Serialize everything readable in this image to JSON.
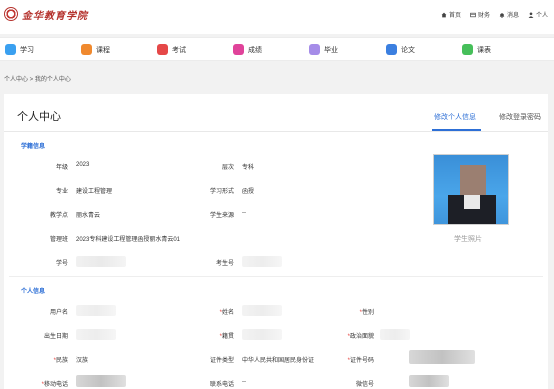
{
  "header": {
    "school_name": "金华教育学院",
    "links": [
      {
        "label": "首页",
        "icon": "home-icon"
      },
      {
        "label": "财务",
        "icon": "finance-icon"
      },
      {
        "label": "消息",
        "icon": "bell-icon"
      },
      {
        "label": "个人",
        "icon": "user-icon"
      }
    ]
  },
  "nav": {
    "items": [
      {
        "label": "学习",
        "icon": "study-icon",
        "color": "#3aa0f0"
      },
      {
        "label": "课程",
        "icon": "course-icon",
        "color": "#f0892e"
      },
      {
        "label": "考试",
        "icon": "exam-icon",
        "color": "#e54848"
      },
      {
        "label": "成绩",
        "icon": "grade-icon",
        "color": "#e0439a"
      },
      {
        "label": "毕业",
        "icon": "graduation-icon",
        "color": "#a58ce8"
      },
      {
        "label": "论文",
        "icon": "thesis-icon",
        "color": "#3b7fe0"
      },
      {
        "label": "课表",
        "icon": "timetable-icon",
        "color": "#46bf5a"
      }
    ]
  },
  "breadcrumb": "个人中心 > 我的个人中心",
  "page": {
    "title": "个人中心",
    "tabs": [
      "修改个人信息",
      "修改登录密码"
    ],
    "active_tab": 0,
    "accent": "#2d6fd6"
  },
  "academic": {
    "title": "学籍信息",
    "fields": {
      "grade_label": "年级",
      "grade_value": "2023",
      "level_label": "层次",
      "level_value": "专科",
      "major_label": "专业",
      "major_value": "建设工程管理",
      "mode_label": "学习形式",
      "mode_value": "函授",
      "site_label": "教学点",
      "site_value": "丽水青云",
      "source_label": "学生来源",
      "source_value": "--",
      "class_label": "管理班",
      "class_value": "2023专科建设工程管理函授丽水青云01",
      "student_id_label": "学号",
      "student_id_value": "",
      "exam_id_label": "考生号",
      "exam_id_value": ""
    },
    "photo_caption": "学生照片"
  },
  "personal": {
    "title": "个人信息",
    "fields": {
      "username_label": "用户名",
      "name_label": "姓名",
      "gender_label": "性别",
      "birth_label": "出生日期",
      "native_label": "籍贯",
      "political_label": "政治面貌",
      "ethnicity_label": "民族",
      "ethnicity_value": "汉族",
      "id_type_label": "证件类型",
      "id_type_value": "中华人民共和国居民身份证",
      "id_number_label": "证件号码",
      "mobile_label": "移动电话",
      "phone_label": "联系电话",
      "phone_value": "--",
      "wechat_label": "微信号"
    },
    "required_mark": "*"
  }
}
